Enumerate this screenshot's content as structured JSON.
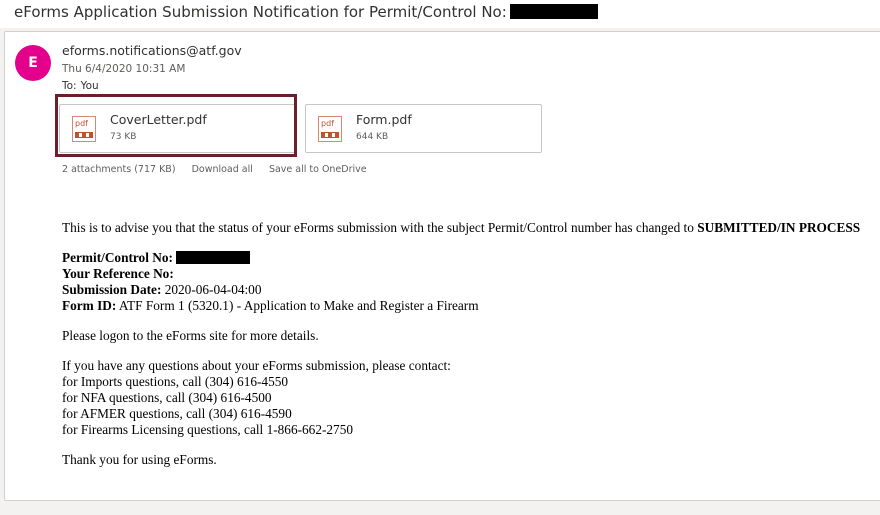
{
  "subject": "eForms Application Submission Notification for Permit/Control No:",
  "avatar_letter": "E",
  "sender": "eforms.notifications@atf.gov",
  "date": "Thu 6/4/2020 10:31 AM",
  "to_label": "To:",
  "to_value": "You",
  "attachments": [
    {
      "name": "CoverLetter.pdf",
      "size": "73 KB",
      "icon": "pdf-file-icon",
      "icon_text": "pdf"
    },
    {
      "name": "Form.pdf",
      "size": "644 KB",
      "icon": "pdf-file-icon",
      "icon_text": "pdf"
    }
  ],
  "attachments_summary": "2 attachments (717 KB)",
  "download_all": "Download all",
  "save_onedrive": "Save all to OneDrive",
  "body": {
    "intro": "This is to advise you that the status of your eForms submission with the subject Permit/Control number has changed to",
    "status": "SUBMITTED/IN PROCESS",
    "permit_label": "Permit/Control No:",
    "reference_label": "Your Reference No:",
    "submission_label": "Submission Date:",
    "submission_value": "2020-06-04-04:00",
    "form_label": "Form ID:",
    "form_value": "ATF Form 1 (5320.1) - Application to Make and Register a Firearm",
    "logon": "Please logon to the eForms site for more details.",
    "questions": "If you have any questions about your eForms submission, please contact:",
    "contacts": [
      "for Imports questions, call (304) 616-4550",
      "for NFA questions, call (304) 616-4500",
      "for AFMER questions, call (304) 616-4590",
      "for Firearms Licensing questions, call 1-866-662-2750"
    ],
    "thanks": "Thank you for using eForms."
  },
  "colors": {
    "avatar": "#e3008c",
    "focus_ring": "#6b1f2a",
    "pdf": "#c4502d"
  }
}
